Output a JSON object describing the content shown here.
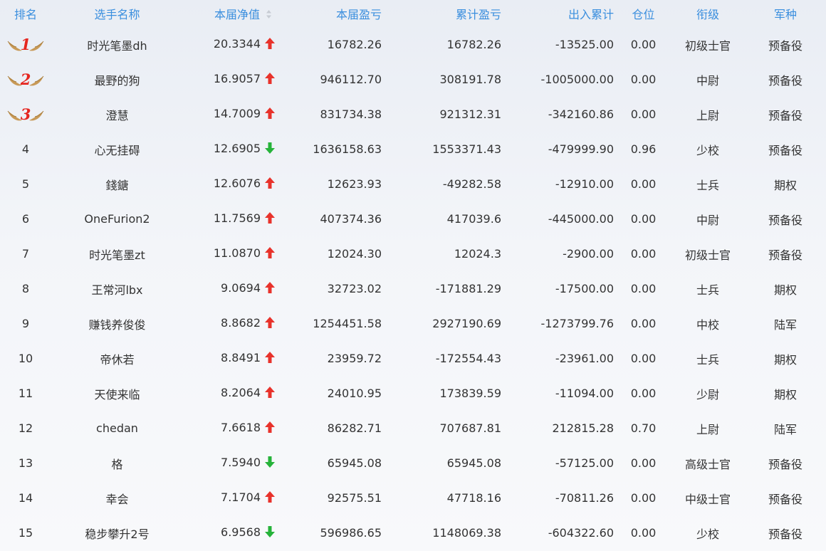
{
  "colors": {
    "header_text": "#3b8fde",
    "up": "#e8322b",
    "down": "#26b33a",
    "medal": "#c89a58",
    "medal_number": "#e52620"
  },
  "headers": {
    "rank": "排名",
    "name": "选手名称",
    "nav": "本届净值",
    "profit": "本届盈亏",
    "cum_profit": "累计盈亏",
    "flow": "出入累计",
    "position": "仓位",
    "grade": "衔级",
    "branch": "军种"
  },
  "rows": [
    {
      "rank": "1",
      "medal": true,
      "name": "时光笔墨dh",
      "nav": "20.3344",
      "trend": "up",
      "profit": "16782.26",
      "cum_profit": "16782.26",
      "flow": "-13525.00",
      "position": "0.00",
      "grade": "初级士官",
      "branch": "预备役"
    },
    {
      "rank": "2",
      "medal": true,
      "name": "最野的狗",
      "nav": "16.9057",
      "trend": "up",
      "profit": "946112.70",
      "cum_profit": "308191.78",
      "flow": "-1005000.00",
      "position": "0.00",
      "grade": "中尉",
      "branch": "预备役"
    },
    {
      "rank": "3",
      "medal": true,
      "name": "澄慧",
      "nav": "14.7009",
      "trend": "up",
      "profit": "831734.38",
      "cum_profit": "921312.31",
      "flow": "-342160.86",
      "position": "0.00",
      "grade": "上尉",
      "branch": "预备役"
    },
    {
      "rank": "4",
      "medal": false,
      "name": "心无挂碍",
      "nav": "12.6905",
      "trend": "down",
      "profit": "1636158.63",
      "cum_profit": "1553371.43",
      "flow": "-479999.90",
      "position": "0.96",
      "grade": "少校",
      "branch": "预备役"
    },
    {
      "rank": "5",
      "medal": false,
      "name": "錢鎕",
      "nav": "12.6076",
      "trend": "up",
      "profit": "12623.93",
      "cum_profit": "-49282.58",
      "flow": "-12910.00",
      "position": "0.00",
      "grade": "士兵",
      "branch": "期权"
    },
    {
      "rank": "6",
      "medal": false,
      "name": "OneFurion2",
      "nav": "11.7569",
      "trend": "up",
      "profit": "407374.36",
      "cum_profit": "417039.6",
      "flow": "-445000.00",
      "position": "0.00",
      "grade": "中尉",
      "branch": "预备役"
    },
    {
      "rank": "7",
      "medal": false,
      "name": "时光笔墨zt",
      "nav": "11.0870",
      "trend": "up",
      "profit": "12024.30",
      "cum_profit": "12024.3",
      "flow": "-2900.00",
      "position": "0.00",
      "grade": "初级士官",
      "branch": "预备役"
    },
    {
      "rank": "8",
      "medal": false,
      "name": "王常河lbx",
      "nav": "9.0694",
      "trend": "up",
      "profit": "32723.02",
      "cum_profit": "-171881.29",
      "flow": "-17500.00",
      "position": "0.00",
      "grade": "士兵",
      "branch": "期权"
    },
    {
      "rank": "9",
      "medal": false,
      "name": "赚钱养俊俊",
      "nav": "8.8682",
      "trend": "up",
      "profit": "1254451.58",
      "cum_profit": "2927190.69",
      "flow": "-1273799.76",
      "position": "0.00",
      "grade": "中校",
      "branch": "陆军"
    },
    {
      "rank": "10",
      "medal": false,
      "name": "帝休若",
      "nav": "8.8491",
      "trend": "up",
      "profit": "23959.72",
      "cum_profit": "-172554.43",
      "flow": "-23961.00",
      "position": "0.00",
      "grade": "士兵",
      "branch": "期权"
    },
    {
      "rank": "11",
      "medal": false,
      "name": "天使来临",
      "nav": "8.2064",
      "trend": "up",
      "profit": "24010.95",
      "cum_profit": "173839.59",
      "flow": "-11094.00",
      "position": "0.00",
      "grade": "少尉",
      "branch": "期权"
    },
    {
      "rank": "12",
      "medal": false,
      "name": "chedan",
      "nav": "7.6618",
      "trend": "up",
      "profit": "86282.71",
      "cum_profit": "707687.81",
      "flow": "212815.28",
      "position": "0.70",
      "grade": "上尉",
      "branch": "陆军"
    },
    {
      "rank": "13",
      "medal": false,
      "name": "格",
      "nav": "7.5940",
      "trend": "down",
      "profit": "65945.08",
      "cum_profit": "65945.08",
      "flow": "-57125.00",
      "position": "0.00",
      "grade": "高级士官",
      "branch": "预备役"
    },
    {
      "rank": "14",
      "medal": false,
      "name": "幸会",
      "nav": "7.1704",
      "trend": "up",
      "profit": "92575.51",
      "cum_profit": "47718.16",
      "flow": "-70811.26",
      "position": "0.00",
      "grade": "中级士官",
      "branch": "预备役"
    },
    {
      "rank": "15",
      "medal": false,
      "name": "稳步攀升2号",
      "nav": "6.9568",
      "trend": "down",
      "profit": "596986.65",
      "cum_profit": "1148069.38",
      "flow": "-604322.60",
      "position": "0.00",
      "grade": "少校",
      "branch": "预备役"
    }
  ]
}
